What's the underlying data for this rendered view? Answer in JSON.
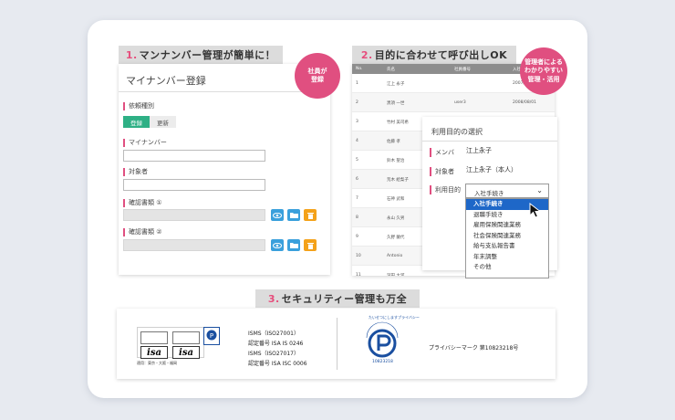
{
  "sections": [
    {
      "num": "1.",
      "title": "マンナンバー管理が簡単に！"
    },
    {
      "num": "2.",
      "title": "目的に合わせて呼び出しOK"
    },
    {
      "num": "3.",
      "title": "セキュリティー管理も万全"
    }
  ],
  "badges": {
    "employee": {
      "line1": "社員が",
      "line2": "登録"
    },
    "manager": {
      "line1": "管理者による",
      "line2": "わかりやすい",
      "line3": "管理・活用"
    }
  },
  "form": {
    "title": "マイナンバー登録",
    "request_type_label": "依頼種別",
    "toggle_register": "登録",
    "toggle_update": "更新",
    "mynumber_label": "マイナンバー",
    "target_label": "対象者",
    "doc1_label": "確認書類 ①",
    "doc2_label": "確認書類 ②",
    "icons": [
      "eye-icon",
      "folder-icon",
      "trash-icon"
    ]
  },
  "table": {
    "headers": [
      "No.",
      "氏名",
      "社員番号",
      "入社"
    ],
    "rows": [
      {
        "no": "1",
        "name": "江上 永子",
        "id": "",
        "date": "2007/"
      },
      {
        "no": "2",
        "name": "黒須 一世",
        "id": "user3",
        "date": "2008/08/01"
      },
      {
        "no": "3",
        "name": "竹村 美司希",
        "id": "",
        "date": ""
      },
      {
        "no": "4",
        "name": "佐藤 孝",
        "id": "",
        "date": ""
      },
      {
        "no": "5",
        "name": "鈴木 聖治",
        "id": "",
        "date": ""
      },
      {
        "no": "6",
        "name": "荒木 絵梨子",
        "id": "",
        "date": ""
      },
      {
        "no": "7",
        "name": "石神 武和",
        "id": "",
        "date": ""
      },
      {
        "no": "8",
        "name": "永山 久男",
        "id": "",
        "date": ""
      },
      {
        "no": "9",
        "name": "久野 蘭代",
        "id": "",
        "date": ""
      },
      {
        "no": "10",
        "name": "Antonio",
        "id": "",
        "date": ""
      },
      {
        "no": "11",
        "name": "深田 大河",
        "id": "",
        "date": ""
      }
    ]
  },
  "purpose_popup": {
    "title": "利用目的の選択",
    "member_label": "メンバ",
    "member_value": "江上永子",
    "target_label": "対象者",
    "target_value": "江上永子（本人）",
    "purpose_label": "利用目的",
    "selected": "入社手続き",
    "options": [
      "入社手続き",
      "退職手続き",
      "雇用保険関連業務",
      "社会保険関連業務",
      "給与支払報告書",
      "年末調整",
      "その他"
    ]
  },
  "security": {
    "isms_lines": [
      "ISMS（ISO27001）",
      "認定番号 ISA IS 0246",
      "ISMS（ISO27017）",
      "認定番号 ISA ISC 0006"
    ],
    "cert_locations": "適用：東京・大阪・福岡",
    "cert_marks": [
      "isa",
      "isa"
    ],
    "privacy_text": "プライバシーマーク 第10823218号",
    "privacy_number": "10823218",
    "privacy_arc": "たいせつにしますプライバシー"
  },
  "colors": {
    "accent": "#e04f80",
    "green": "#2eb085",
    "blue": "#3aa0dc",
    "orange": "#f4a21a",
    "select_blue": "#1e67c8"
  }
}
